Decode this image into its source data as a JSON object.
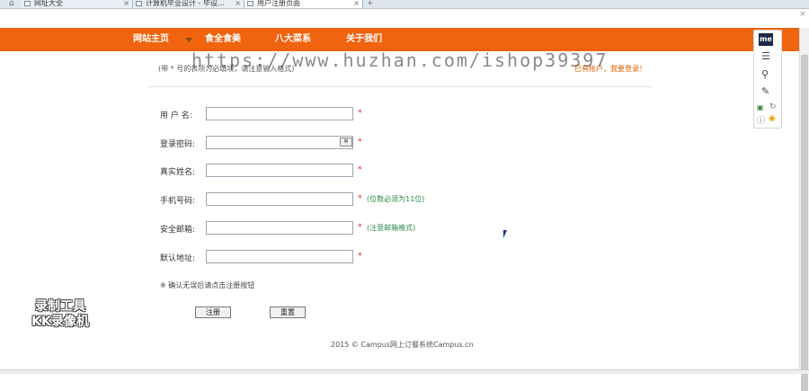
{
  "browser": {
    "tabs": [
      {
        "label": "网址大全"
      },
      {
        "label": "计算机毕业设计 - 毕设..."
      },
      {
        "label": "用户注册页面"
      }
    ]
  },
  "nav": {
    "items": [
      "网站主页",
      "食全食美",
      "八大菜系",
      "关于我们"
    ]
  },
  "notice": {
    "text": "(带 * 号的表项为必填项，请注意输入格式)",
    "login": "已有账户，我要登录！"
  },
  "form": {
    "fields": [
      {
        "label": "用 户 名:",
        "value": "",
        "required": "*",
        "hint": ""
      },
      {
        "label": "登录密码:",
        "value": "",
        "required": "*",
        "hint": ""
      },
      {
        "label": "真实姓名:",
        "value": "",
        "required": "*",
        "hint": ""
      },
      {
        "label": "手机号码:",
        "value": "",
        "required": "*",
        "hint": "(位数必须为11位)"
      },
      {
        "label": "安全邮箱:",
        "value": "",
        "required": "*",
        "hint": "(注意邮箱格式)"
      },
      {
        "label": "默认地址:",
        "value": "",
        "required": "*",
        "hint": ""
      }
    ],
    "note": "※ 确认无误后请点击注册按钮",
    "submit_label": "注册",
    "reset_label": "重置"
  },
  "footer": {
    "text": "2015 © Campus网上订餐系统Campus.cn"
  },
  "watermark": {
    "text": "https://www.huzhan.com/ishop39397"
  },
  "recorder": {
    "line1": "录制工具",
    "line2": "KK录像机"
  },
  "toolbox": {
    "logo": "me"
  },
  "colors": {
    "accent": "#f0640f",
    "required": "#e02020",
    "hint": "#2a8a4a",
    "link": "#e06000"
  }
}
